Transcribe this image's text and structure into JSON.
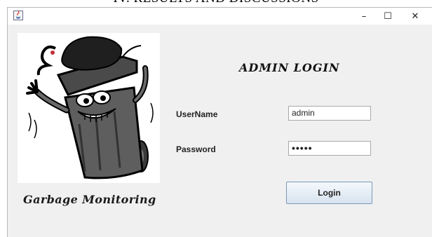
{
  "document": {
    "heading": "IV. RESULTS AND DISCUSSIONS"
  },
  "window": {
    "titlebar": {
      "app_icon": "java-icon",
      "minimize_glyph": "–",
      "maximize_glyph": "☐",
      "close_glyph": "✕"
    }
  },
  "brand": {
    "mascot_icon": "garbage-bin-mascot-icon",
    "caption": "Garbage Monitoring"
  },
  "login": {
    "heading": "ADMIN LOGIN",
    "username_label": "UserName",
    "username_value": "admin",
    "password_label": "Password",
    "password_value": "•••••",
    "login_button": "Login"
  },
  "colors": {
    "window_bg": "#f0f0f0",
    "titlebar_bg": "#ffffff",
    "button_border": "#7a98b8"
  }
}
